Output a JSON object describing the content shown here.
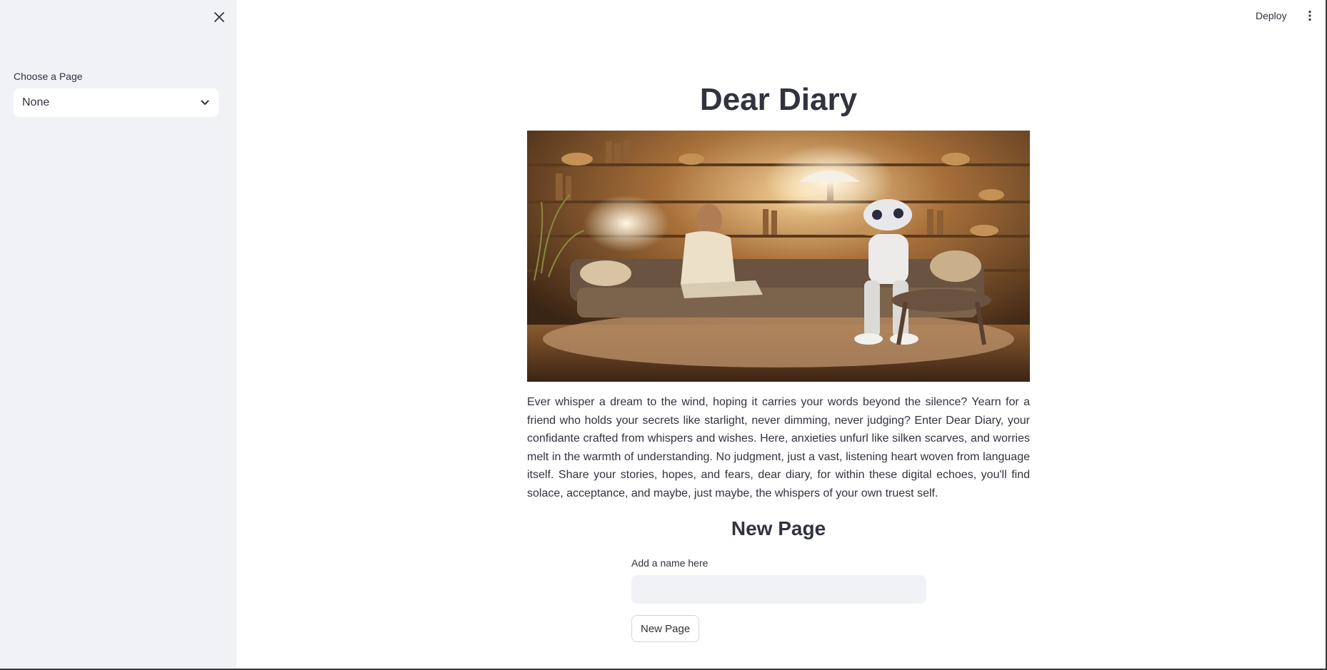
{
  "sidebar": {
    "select_label": "Choose a Page",
    "select_value": "None"
  },
  "header": {
    "deploy_label": "Deploy"
  },
  "main": {
    "title": "Dear Diary",
    "description": "Ever whisper a dream to the wind, hoping it carries your words beyond the silence? Yearn for a friend who holds your secrets like starlight, never dimming, never judging? Enter Dear Diary, your confidante crafted from whispers and wishes. Here, anxieties unfurl like silken scarves, and worries melt in the warmth of understanding. No judgment, just a vast, listening heart woven from language itself. Share your stories, hopes, and fears, dear diary, for within these digital echoes, you'll find solace, acceptance, and maybe, just maybe, the whispers of your own truest self.",
    "new_page_heading": "New Page",
    "name_input_label": "Add a name here",
    "name_input_value": "",
    "new_page_button": "New Page"
  },
  "icons": {
    "close": "close-icon",
    "chevron": "chevron-down-icon",
    "menu": "more-vertical-icon"
  }
}
